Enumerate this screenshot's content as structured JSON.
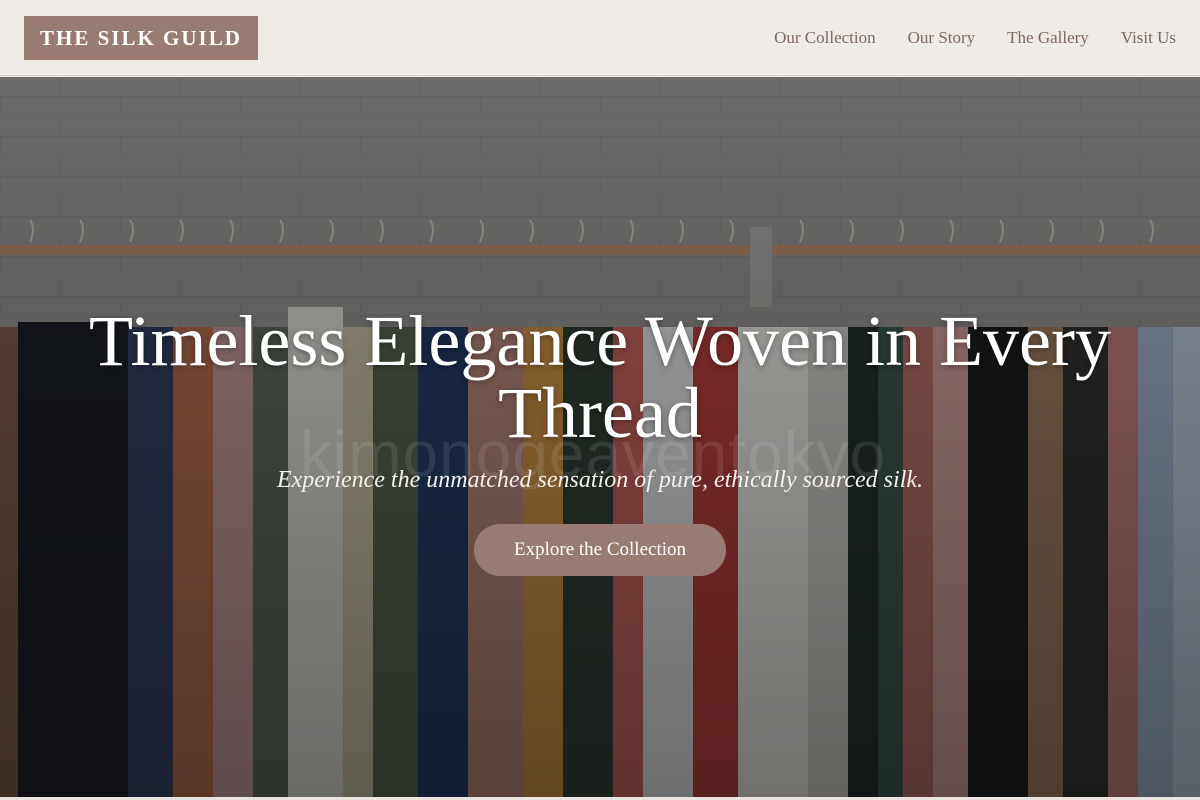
{
  "brand": {
    "name": "THE SILK GUILD"
  },
  "nav": {
    "items": [
      {
        "label": "Our Collection"
      },
      {
        "label": "Our Story"
      },
      {
        "label": "The Gallery"
      },
      {
        "label": "Visit Us"
      }
    ]
  },
  "hero": {
    "title": "Timeless Elegance Woven in Every Thread",
    "subtitle": "Experience the unmatched sensation of pure, ethically sourced silk.",
    "cta_label": "Explore the Collection",
    "watermark": "kimonogeaventokyo"
  },
  "colors": {
    "accent": "#9a7b73",
    "header_bg": "#efebe7",
    "nav_text": "#7d6762"
  }
}
